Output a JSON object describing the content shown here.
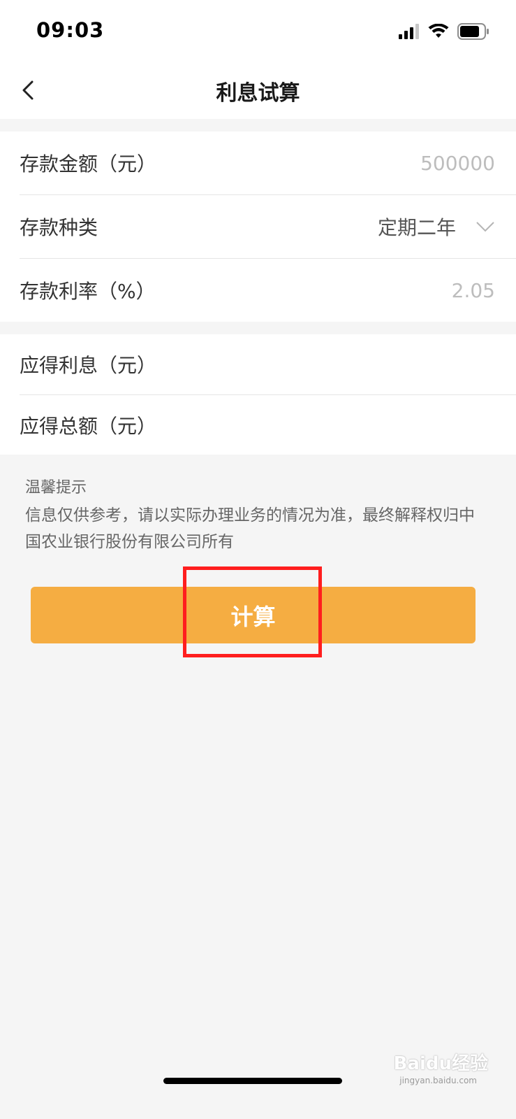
{
  "status_bar": {
    "time": "09:03"
  },
  "nav": {
    "title": "利息试算"
  },
  "form": {
    "amount_label": "存款金额（元）",
    "amount_value": "500000",
    "type_label": "存款种类",
    "type_value": "定期二年",
    "rate_label": "存款利率（%）",
    "rate_value": "2.05",
    "interest_label": "应得利息（元）",
    "total_label": "应得总额（元）"
  },
  "tips": {
    "title": "温馨提示",
    "body": "信息仅供参考，请以实际办理业务的情况为准，最终解释权归中国农业银行股份有限公司所有"
  },
  "calculate_button": {
    "label": "计算"
  },
  "watermark": {
    "text": "Baidu经验",
    "sub": "jingyan.baidu.com"
  },
  "colors": {
    "accent": "#f5ad42",
    "highlight": "#ff1e1e",
    "background": "#f5f5f5"
  }
}
